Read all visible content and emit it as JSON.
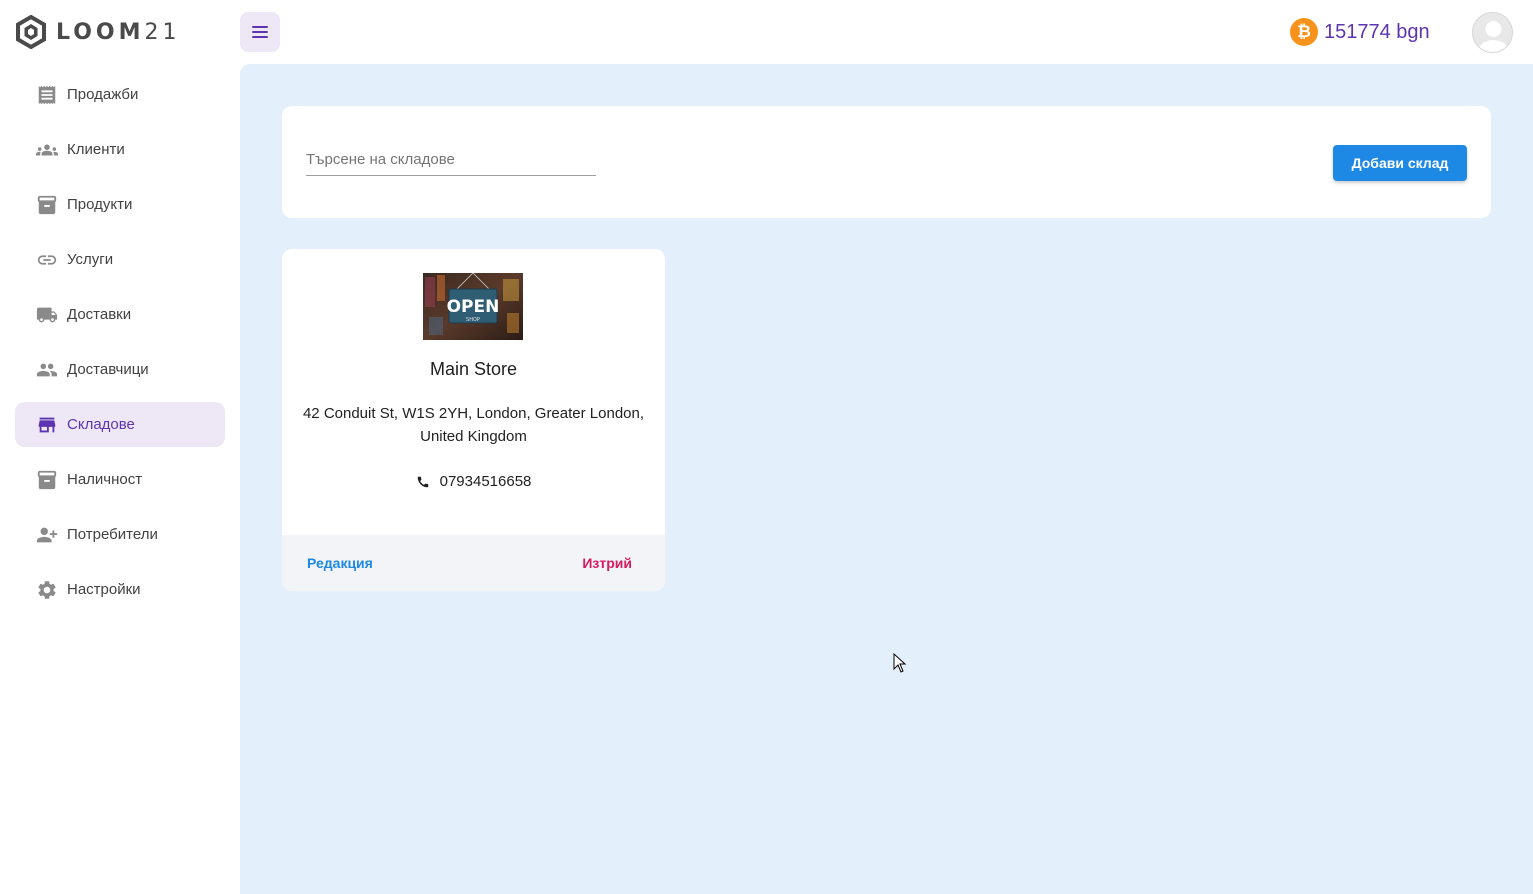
{
  "app": {
    "logo_text": "LOOM",
    "logo_num": "21"
  },
  "sidebar": {
    "items": [
      {
        "label": "Продажби",
        "icon": "receipt-icon"
      },
      {
        "label": "Клиенти",
        "icon": "people-icon"
      },
      {
        "label": "Продукти",
        "icon": "archive-icon"
      },
      {
        "label": "Услуги",
        "icon": "link-icon"
      },
      {
        "label": "Доставки",
        "icon": "truck-icon"
      },
      {
        "label": "Доставчици",
        "icon": "group-icon"
      },
      {
        "label": "Складове",
        "icon": "store-icon",
        "active": true
      },
      {
        "label": "Наличност",
        "icon": "inventory-icon"
      },
      {
        "label": "Потребители",
        "icon": "person-add-icon"
      },
      {
        "label": "Настройки",
        "icon": "gear-icon"
      }
    ]
  },
  "header": {
    "balance": "151774 bgn",
    "currency_symbol": "₿"
  },
  "search": {
    "placeholder": "Търсене на складове",
    "value": ""
  },
  "actions": {
    "add_label": "Добави склад"
  },
  "warehouses": [
    {
      "image_sign_text": "OPEN",
      "image_sign_subtext": "SHOP",
      "name": "Main Store",
      "address": "42 Conduit St, W1S 2YH, London, Greater London, United Kingdom",
      "phone": "07934516658",
      "edit_label": "Редакция",
      "delete_label": "Изтрий"
    }
  ],
  "colors": {
    "accent": "#5e35b1",
    "primary": "#1e88e5",
    "danger": "#d81b60",
    "main_bg": "#e3effb"
  }
}
